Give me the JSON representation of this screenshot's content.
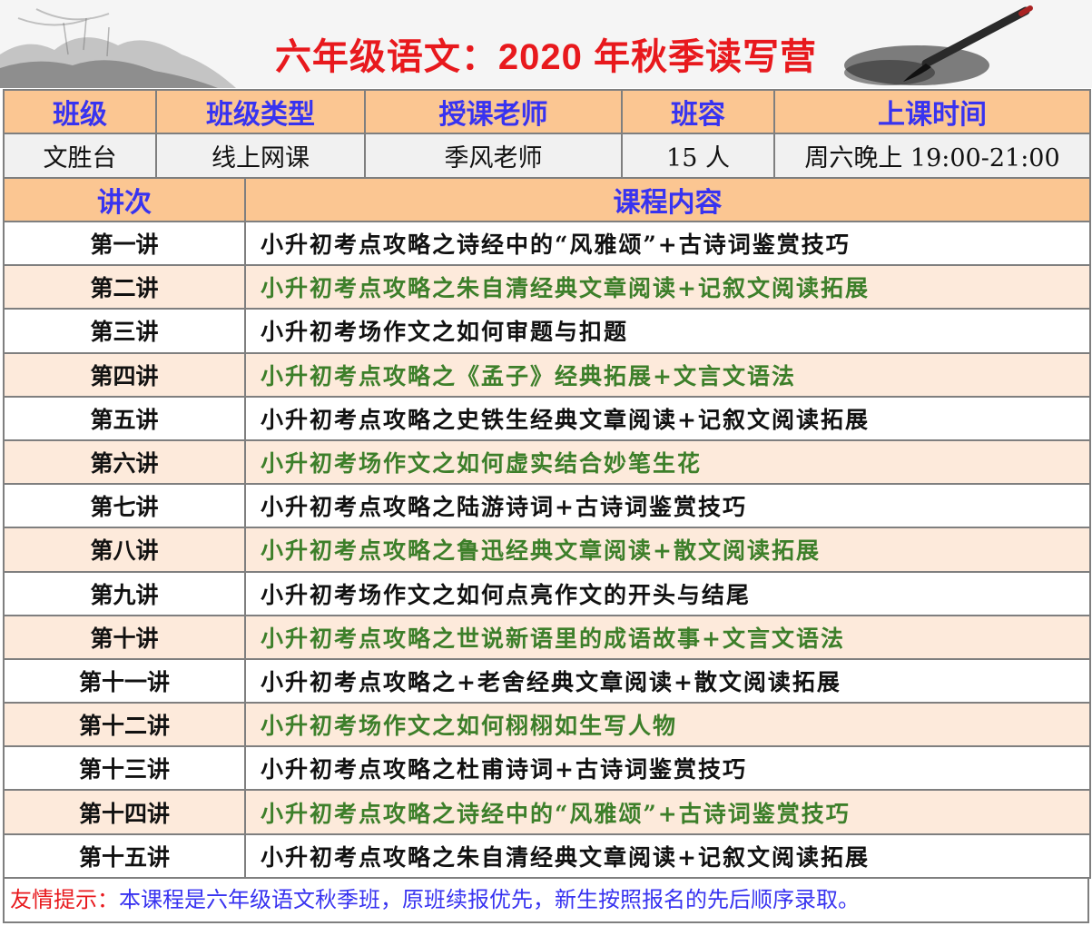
{
  "title": "六年级语文：2020 年秋季读写营",
  "info_table": {
    "headers": [
      "班级",
      "班级类型",
      "授课老师",
      "班容",
      "上课时间"
    ],
    "values": [
      "文胜台",
      "线上网课",
      "季风老师",
      "15 人",
      "周六晚上 19:00-21:00"
    ]
  },
  "schedule": {
    "headers": [
      "讲次",
      "课程内容"
    ],
    "rows": [
      {
        "lecture": "第一讲",
        "content": "小升初考点攻略之诗经中的“风雅颂”+古诗词鉴赏技巧"
      },
      {
        "lecture": "第二讲",
        "content": "小升初考点攻略之朱自清经典文章阅读+记叙文阅读拓展"
      },
      {
        "lecture": "第三讲",
        "content": "小升初考场作文之如何审题与扣题"
      },
      {
        "lecture": "第四讲",
        "content": "小升初考点攻略之《孟子》经典拓展+文言文语法"
      },
      {
        "lecture": "第五讲",
        "content": "小升初考点攻略之史铁生经典文章阅读+记叙文阅读拓展"
      },
      {
        "lecture": "第六讲",
        "content": "小升初考场作文之如何虚实结合妙笔生花"
      },
      {
        "lecture": "第七讲",
        "content": "小升初考点攻略之陆游诗词+古诗词鉴赏技巧"
      },
      {
        "lecture": "第八讲",
        "content": "小升初考点攻略之鲁迅经典文章阅读+散文阅读拓展"
      },
      {
        "lecture": "第九讲",
        "content": "小升初考场作文之如何点亮作文的开头与结尾"
      },
      {
        "lecture": "第十讲",
        "content": "小升初考点攻略之世说新语里的成语故事+文言文语法"
      },
      {
        "lecture": "第十一讲",
        "content": "小升初考点攻略之+老舍经典文章阅读+散文阅读拓展"
      },
      {
        "lecture": "第十二讲",
        "content": "小升初考场作文之如何栩栩如生写人物"
      },
      {
        "lecture": "第十三讲",
        "content": "小升初考点攻略之杜甫诗词+古诗词鉴赏技巧"
      },
      {
        "lecture": "第十四讲",
        "content": "小升初考点攻略之诗经中的“风雅颂”+古诗词鉴赏技巧"
      },
      {
        "lecture": "第十五讲",
        "content": "小升初考点攻略之朱自清经典文章阅读+记叙文阅读拓展"
      }
    ]
  },
  "footer": {
    "label": "友情提示：",
    "text": "本课程是六年级语文秋季班，原班续报优先，新生按照报名的先后顺序录取。"
  },
  "colors": {
    "title_red": "#e8191d",
    "header_blue": "#3833f0",
    "header_bg": "#fbc692",
    "row_alt_bg": "#fdeadb",
    "alt_text_green": "#3d7f2a"
  },
  "icons": {
    "banner_left": "ink-landscape-icon",
    "banner_right": "calligraphy-brush-icon"
  }
}
